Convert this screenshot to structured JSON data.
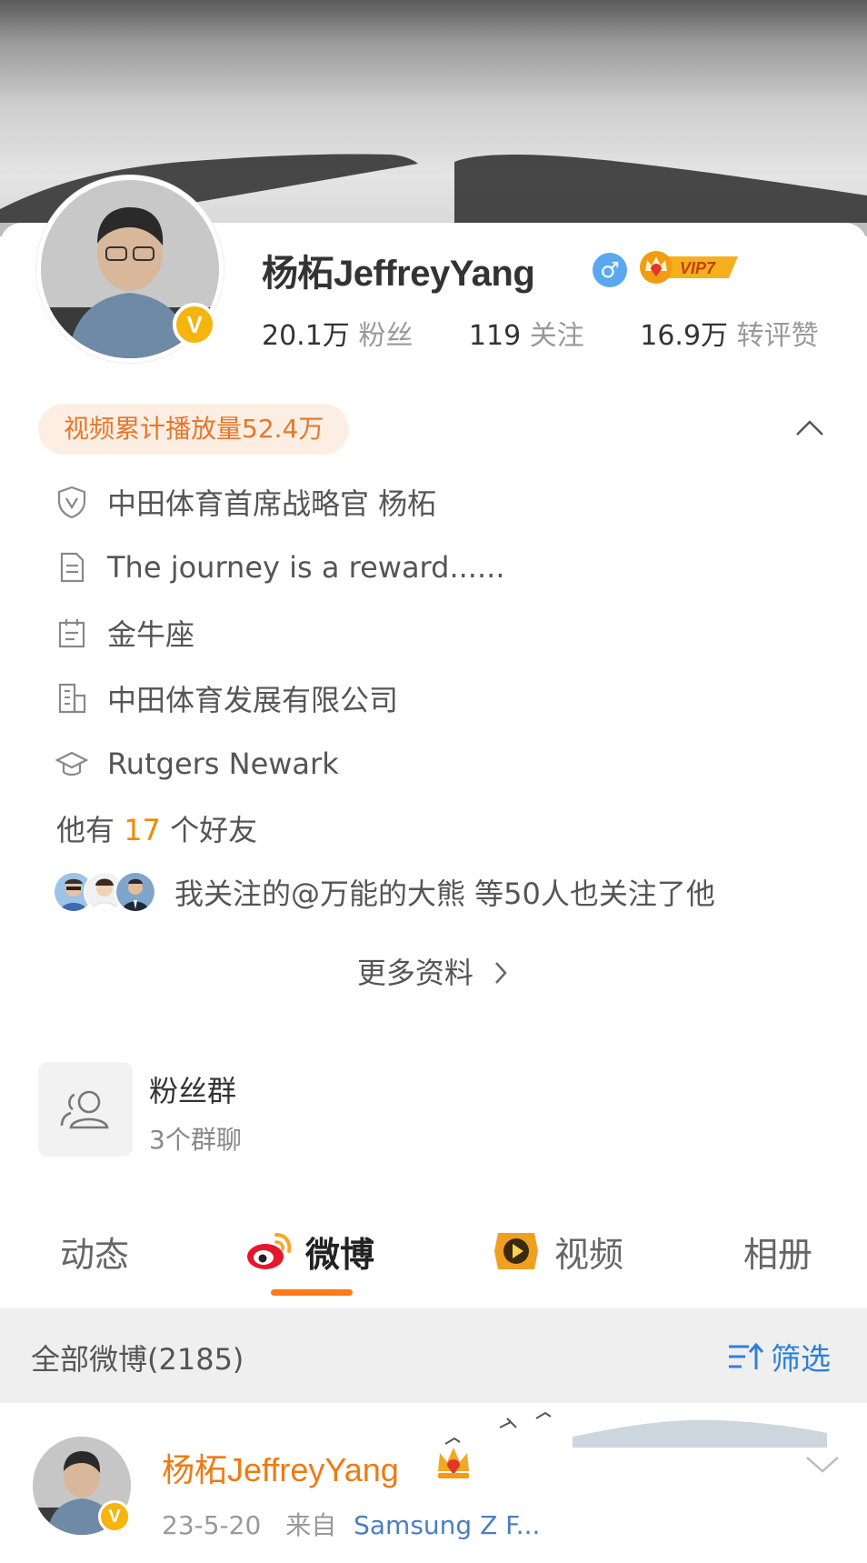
{
  "profile": {
    "name": "杨柘JeffreyYang",
    "avatar_badge": "V",
    "vip_label": "VIP7",
    "gender_symbol": "♂",
    "followers_num": "20.1万",
    "followers_label": "粉丝",
    "following_num": "119",
    "following_label": "关注",
    "likes_num": "16.9万",
    "likes_label": "转评赞"
  },
  "video_stat": "视频累计播放量52.4万",
  "info": {
    "title": "中田体育首席战略官 杨柘",
    "bio": "The journey is a reward......",
    "zodiac": "金牛座",
    "company": "中田体育发展有限公司",
    "school": "Rutgers Newark"
  },
  "friends": {
    "prefix": "他有",
    "count": "17",
    "suffix": "个好友"
  },
  "mutual_text": "我关注的@万能的大熊 等50人也关注了他",
  "more_label": "更多资料",
  "fan_group": {
    "title": "粉丝群",
    "subtitle": "3个群聊"
  },
  "tabs": [
    {
      "label": "动态",
      "active": false
    },
    {
      "label": "微博",
      "active": true
    },
    {
      "label": "视频",
      "active": false
    },
    {
      "label": "相册",
      "active": false
    }
  ],
  "filter": {
    "count_label": "全部微博(2185)",
    "button_label": "筛选"
  },
  "post": {
    "author": "杨柘JeffreyYang",
    "badge": "V",
    "date": "23-5-20",
    "from_label": "来自",
    "source": "Samsung Z F..."
  },
  "colors": {
    "accent_orange": "#ff7a1a",
    "link_blue": "#2f7fd8",
    "verified_gold": "#f6b40e",
    "friends_count": "#f08a00"
  }
}
